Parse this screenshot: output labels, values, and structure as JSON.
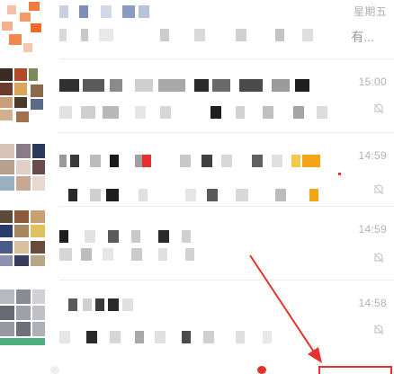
{
  "chats": [
    {
      "id": "chat-1",
      "time": "星期五",
      "preview_tail": "有...",
      "muted": false
    },
    {
      "id": "chat-2",
      "time": "15:00",
      "preview_tail": "",
      "muted": true
    },
    {
      "id": "chat-3",
      "time": "14:59",
      "preview_tail": "",
      "muted": true
    },
    {
      "id": "chat-4",
      "time": "14:59",
      "preview_tail": "",
      "muted": true
    },
    {
      "id": "chat-5",
      "time": "14:58",
      "preview_tail": "",
      "muted": true
    }
  ],
  "colors": {
    "arrow": "#e5322d",
    "highlight_box": "#e5322d",
    "time_text": "#b2b2b2",
    "divider": "#ececec",
    "mute_icon": "#c8c8c8"
  },
  "icons": {
    "mute": "bell-muted-icon"
  }
}
